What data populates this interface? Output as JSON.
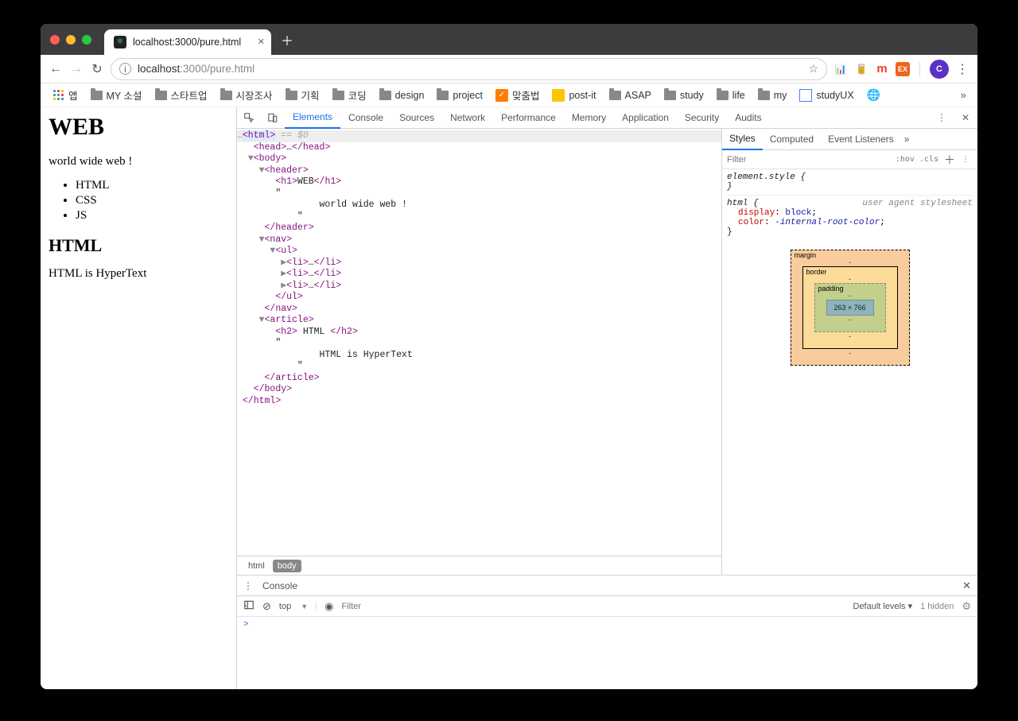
{
  "tab": {
    "title": "localhost:3000/pure.html"
  },
  "address": {
    "host": "localhost",
    "path": ":3000/pure.html"
  },
  "nav": {
    "back": "←",
    "forward": "→",
    "reload": "↻"
  },
  "extensions": [
    "📊",
    "🥫",
    "m",
    "EX"
  ],
  "avatar": "C",
  "bookmarks": {
    "apps": "앱",
    "items": [
      "MY 소설",
      "스타트업",
      "시장조사",
      "기획",
      "코딩",
      "design",
      "project"
    ],
    "icon_items": [
      {
        "icon": "✓",
        "cls": "orange",
        "label": "맞춤법"
      },
      {
        "icon": "",
        "cls": "yellow",
        "label": "post-it"
      }
    ],
    "items2": [
      "ASAP",
      "study",
      "life",
      "my"
    ],
    "boxed": "studyUX"
  },
  "page": {
    "h1": "WEB",
    "p1": "world wide web !",
    "li": [
      "HTML",
      "CSS",
      "JS"
    ],
    "h2": "HTML",
    "p2": "HTML is HyperText"
  },
  "devtools_tabs": [
    "Elements",
    "Console",
    "Sources",
    "Network",
    "Performance",
    "Memory",
    "Application",
    "Security",
    "Audits"
  ],
  "devtools_active": "Elements",
  "dom_toptext": "…<html> == $0",
  "dom": [
    "  <head>…</head>",
    " ▼<body>",
    "   ▼<header>",
    "      <h1>WEB</h1>",
    "      \"",
    "              world wide web !",
    "          \"",
    "    </header>",
    "   ▼<nav>",
    "     ▼<ul>",
    "       ▶<li>…</li>",
    "       ▶<li>…</li>",
    "       ▶<li>…</li>",
    "      </ul>",
    "    </nav>",
    "   ▼<article>",
    "      <h2> HTML </h2>",
    "      \"",
    "              HTML is HyperText",
    "          \"",
    "    </article>",
    "  </body>",
    "</html>"
  ],
  "crumbs": [
    "html",
    "body"
  ],
  "styles_tabs": [
    "Styles",
    "Computed",
    "Event Listeners"
  ],
  "styles_active": "Styles",
  "filter": {
    "placeholder": "Filter",
    "hov": ":hov",
    "cls": ".cls"
  },
  "style_rules": {
    "element_style": "element.style {",
    "close": "}",
    "html_sel": "html {",
    "uas": "user agent stylesheet",
    "p1": {
      "k": "display",
      "v": "block"
    },
    "p2": {
      "k": "color",
      "v": "-internal-root-color"
    }
  },
  "boxmodel": {
    "margin": "margin",
    "border": "border",
    "padding": "padding",
    "dash": "-",
    "content": "263 × 766"
  },
  "console": {
    "title": "Console",
    "top": "top",
    "filter_placeholder": "Filter",
    "levels": "Default levels ▾",
    "hidden": "1 hidden",
    "prompt": ">"
  }
}
